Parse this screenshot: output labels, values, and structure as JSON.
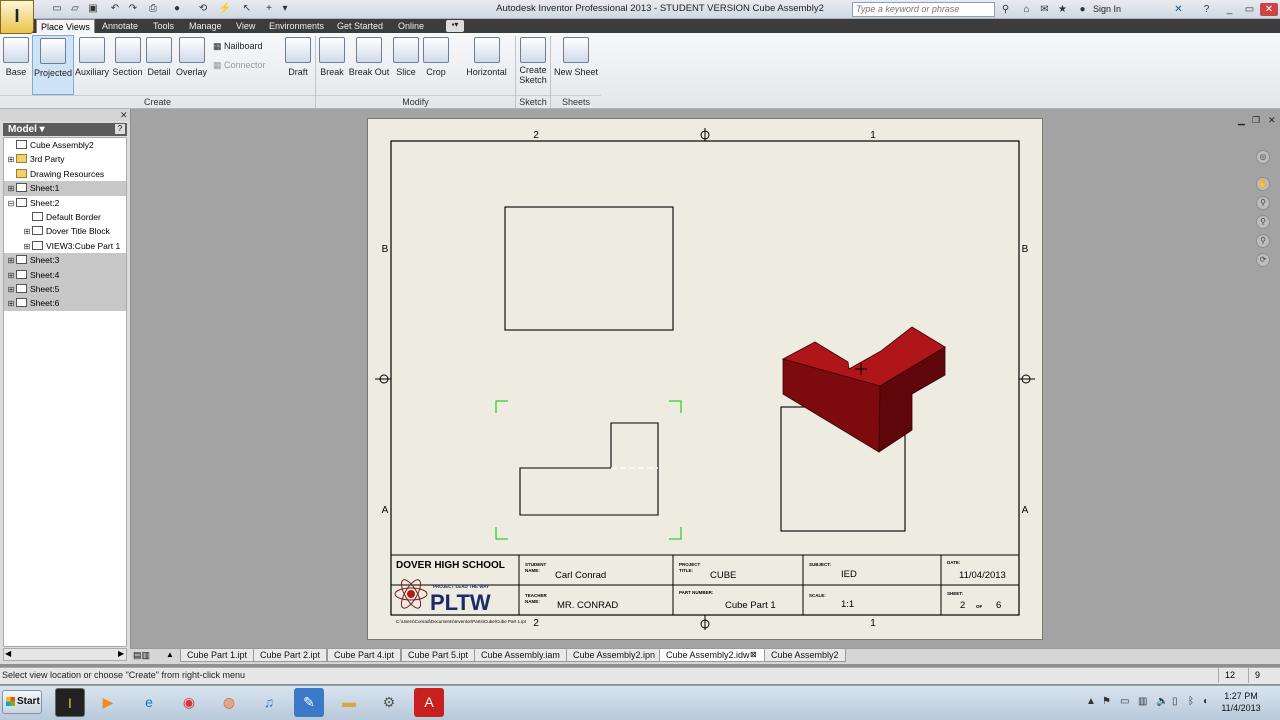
{
  "title_bar": {
    "title": "Autodesk Inventor Professional 2013 - STUDENT VERSION   Cube Assembly2",
    "search_placeholder": "Type a keyword or phrase",
    "sign_in": "Sign In"
  },
  "menu": {
    "tabs": [
      "Place Views",
      "Annotate",
      "Tools",
      "Manage",
      "View",
      "Environments",
      "Get Started",
      "Online"
    ],
    "active": "Place Views"
  },
  "ribbon": {
    "create_buttons": [
      "Base",
      "Projected",
      "Auxiliary",
      "Section",
      "Detail",
      "Overlay"
    ],
    "nailboard": "Nailboard",
    "connector": "Connector",
    "modify_buttons": [
      "Draft",
      "Break",
      "Break Out",
      "Slice",
      "Crop"
    ],
    "horizontal": "Horizontal",
    "create_sketch_line1": "Create",
    "create_sketch_line2": "Sketch",
    "new_sheet": "New Sheet",
    "panels": {
      "create": "Create",
      "modify": "Modify",
      "sketch": "Sketch",
      "sheets": "Sheets"
    }
  },
  "browser": {
    "header": "Model",
    "help": "?",
    "items": [
      {
        "label": "Cube Assembly2",
        "level": 0,
        "twisty": "",
        "selected": false
      },
      {
        "label": "3rd Party",
        "level": 0,
        "twisty": "+",
        "selected": false
      },
      {
        "label": "Drawing Resources",
        "level": 0,
        "twisty": "",
        "selected": false
      },
      {
        "label": "Sheet:1",
        "level": 0,
        "twisty": "+",
        "selected": true
      },
      {
        "label": "Sheet:2",
        "level": 0,
        "twisty": "-",
        "selected": false
      },
      {
        "label": "Default Border",
        "level": 1,
        "twisty": "",
        "selected": false
      },
      {
        "label": "Dover Title Block",
        "level": 1,
        "twisty": "+",
        "selected": false
      },
      {
        "label": "VIEW3:Cube Part 1",
        "level": 1,
        "twisty": "+",
        "selected": false
      },
      {
        "label": "Sheet:3",
        "level": 0,
        "twisty": "+",
        "selected": true
      },
      {
        "label": "Sheet:4",
        "level": 0,
        "twisty": "+",
        "selected": true
      },
      {
        "label": "Sheet:5",
        "level": 0,
        "twisty": "+",
        "selected": true
      },
      {
        "label": "Sheet:6",
        "level": 0,
        "twisty": "+",
        "selected": true
      }
    ]
  },
  "sheet": {
    "zone_top_left": "2",
    "zone_top_right": "1",
    "zone_bottom_left": "2",
    "zone_bottom_right": "1",
    "zone_left_top": "B",
    "zone_left_bottom": "A",
    "zone_right_top": "B",
    "zone_right_bottom": "A",
    "part_color": "#8b0d12",
    "title_block": {
      "school": "DOVER HIGH SCHOOL",
      "student_label_1": "STUDENT",
      "student_label_2": "NAME:",
      "student_name": "Carl Conrad",
      "teacher_label_1": "TEACHER",
      "teacher_label_2": "NAME:",
      "teacher_name": "MR. CONRAD",
      "project_label_1": "PROJECT",
      "project_label_2": "TITLE:",
      "project_title": "CUBE",
      "part_number_label": "PART NUMBER:",
      "part_number": "Cube Part 1",
      "subject_label": "SUBJECT:",
      "subject": "IED",
      "scale_label": "SCALE:",
      "scale": "1:1",
      "date_label": "DATE:",
      "date": "11/04/2013",
      "sheet_label": "SHEET:",
      "sheet_num": "2",
      "sheet_of": "OF",
      "sheet_total": "6",
      "pltw_small": "PROJECT LEAD THE WAY",
      "pltw": "PLTW",
      "file_path": "C:\\Users\\Conrad\\Documents\\Inventor\\Parts\\Cube\\Cube Part 1.ipt"
    }
  },
  "doc_tabs": [
    {
      "label": "Cube Part 1.ipt",
      "active": false
    },
    {
      "label": "Cube Part 2.ipt",
      "active": false
    },
    {
      "label": "Cube Part 4.ipt",
      "active": false
    },
    {
      "label": "Cube Part 5.ipt",
      "active": false
    },
    {
      "label": "Cube Assembly.iam",
      "active": false
    },
    {
      "label": "Cube Assembly2.ipn",
      "active": false
    },
    {
      "label": "Cube Assembly2.idw",
      "active": true
    },
    {
      "label": "Cube Assembly2",
      "active": false
    }
  ],
  "status": {
    "text": "Select view location or choose \"Create\" from right-click menu",
    "val1": "12",
    "val2": "9"
  },
  "taskbar": {
    "start": "Start",
    "time": "1:27 PM",
    "date": "11/4/2013"
  }
}
